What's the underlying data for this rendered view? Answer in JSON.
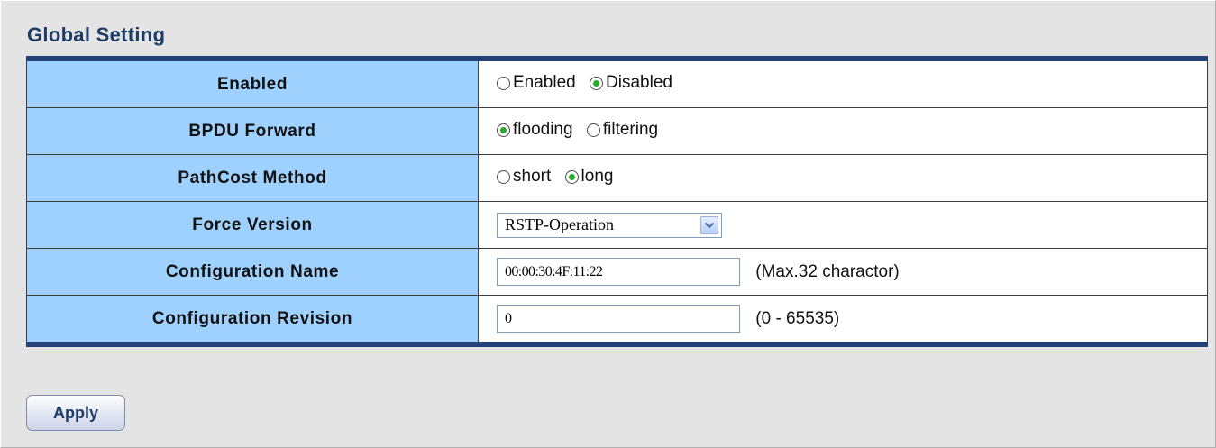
{
  "section": {
    "title": "Global Setting"
  },
  "rows": {
    "enabled": {
      "label": "Enabled",
      "options": [
        "Enabled",
        "Disabled"
      ],
      "selected": "Disabled"
    },
    "bpdu_forward": {
      "label": "BPDU Forward",
      "options": [
        "flooding",
        "filtering"
      ],
      "selected": "flooding"
    },
    "pathcost_method": {
      "label": "PathCost Method",
      "options": [
        "short",
        "long"
      ],
      "selected": "long"
    },
    "force_version": {
      "label": "Force Version",
      "selected_value": "RSTP-Operation"
    },
    "configuration_name": {
      "label": "Configuration Name",
      "value": "00:00:30:4F:11:22",
      "hint": "(Max.32 charactor)"
    },
    "configuration_revision": {
      "label": "Configuration Revision",
      "value": "0",
      "hint": "(0 - 65535)"
    }
  },
  "actions": {
    "apply_label": "Apply"
  },
  "colors": {
    "label_background": "#9fd1ff",
    "table_border_accent": "#24427a",
    "radio_checked": "#2aa82a",
    "title_text": "#1e3d66"
  }
}
